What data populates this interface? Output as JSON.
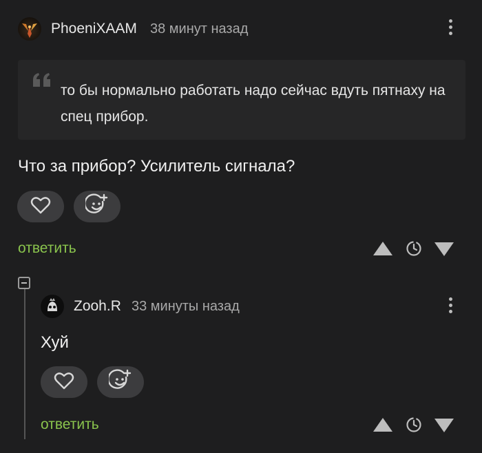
{
  "comment1": {
    "author": "PhoeniXAAM",
    "time": "38 минут назад",
    "quote": "то бы нормально работать надо сейчас вдуть пятнаху на спец прибор.",
    "text": "Что за прибор? Усилитель сигнала?",
    "reply_label": "ответить"
  },
  "comment2": {
    "author": "Zooh.R",
    "time": "33 минуты назад",
    "text": "Хуй",
    "reply_label": "ответить"
  },
  "icons": {
    "like": "heart-icon",
    "react": "smiley-plus-icon",
    "more": "more-vertical-icon",
    "vote_up": "triangle-up-icon",
    "vote_down": "triangle-down-icon",
    "save": "clock-icon",
    "collapse": "minus-square-icon",
    "quote": "quote-icon"
  },
  "colors": {
    "background": "#1e1e1f",
    "link": "#8ac44d",
    "button": "#3c3c3e"
  }
}
